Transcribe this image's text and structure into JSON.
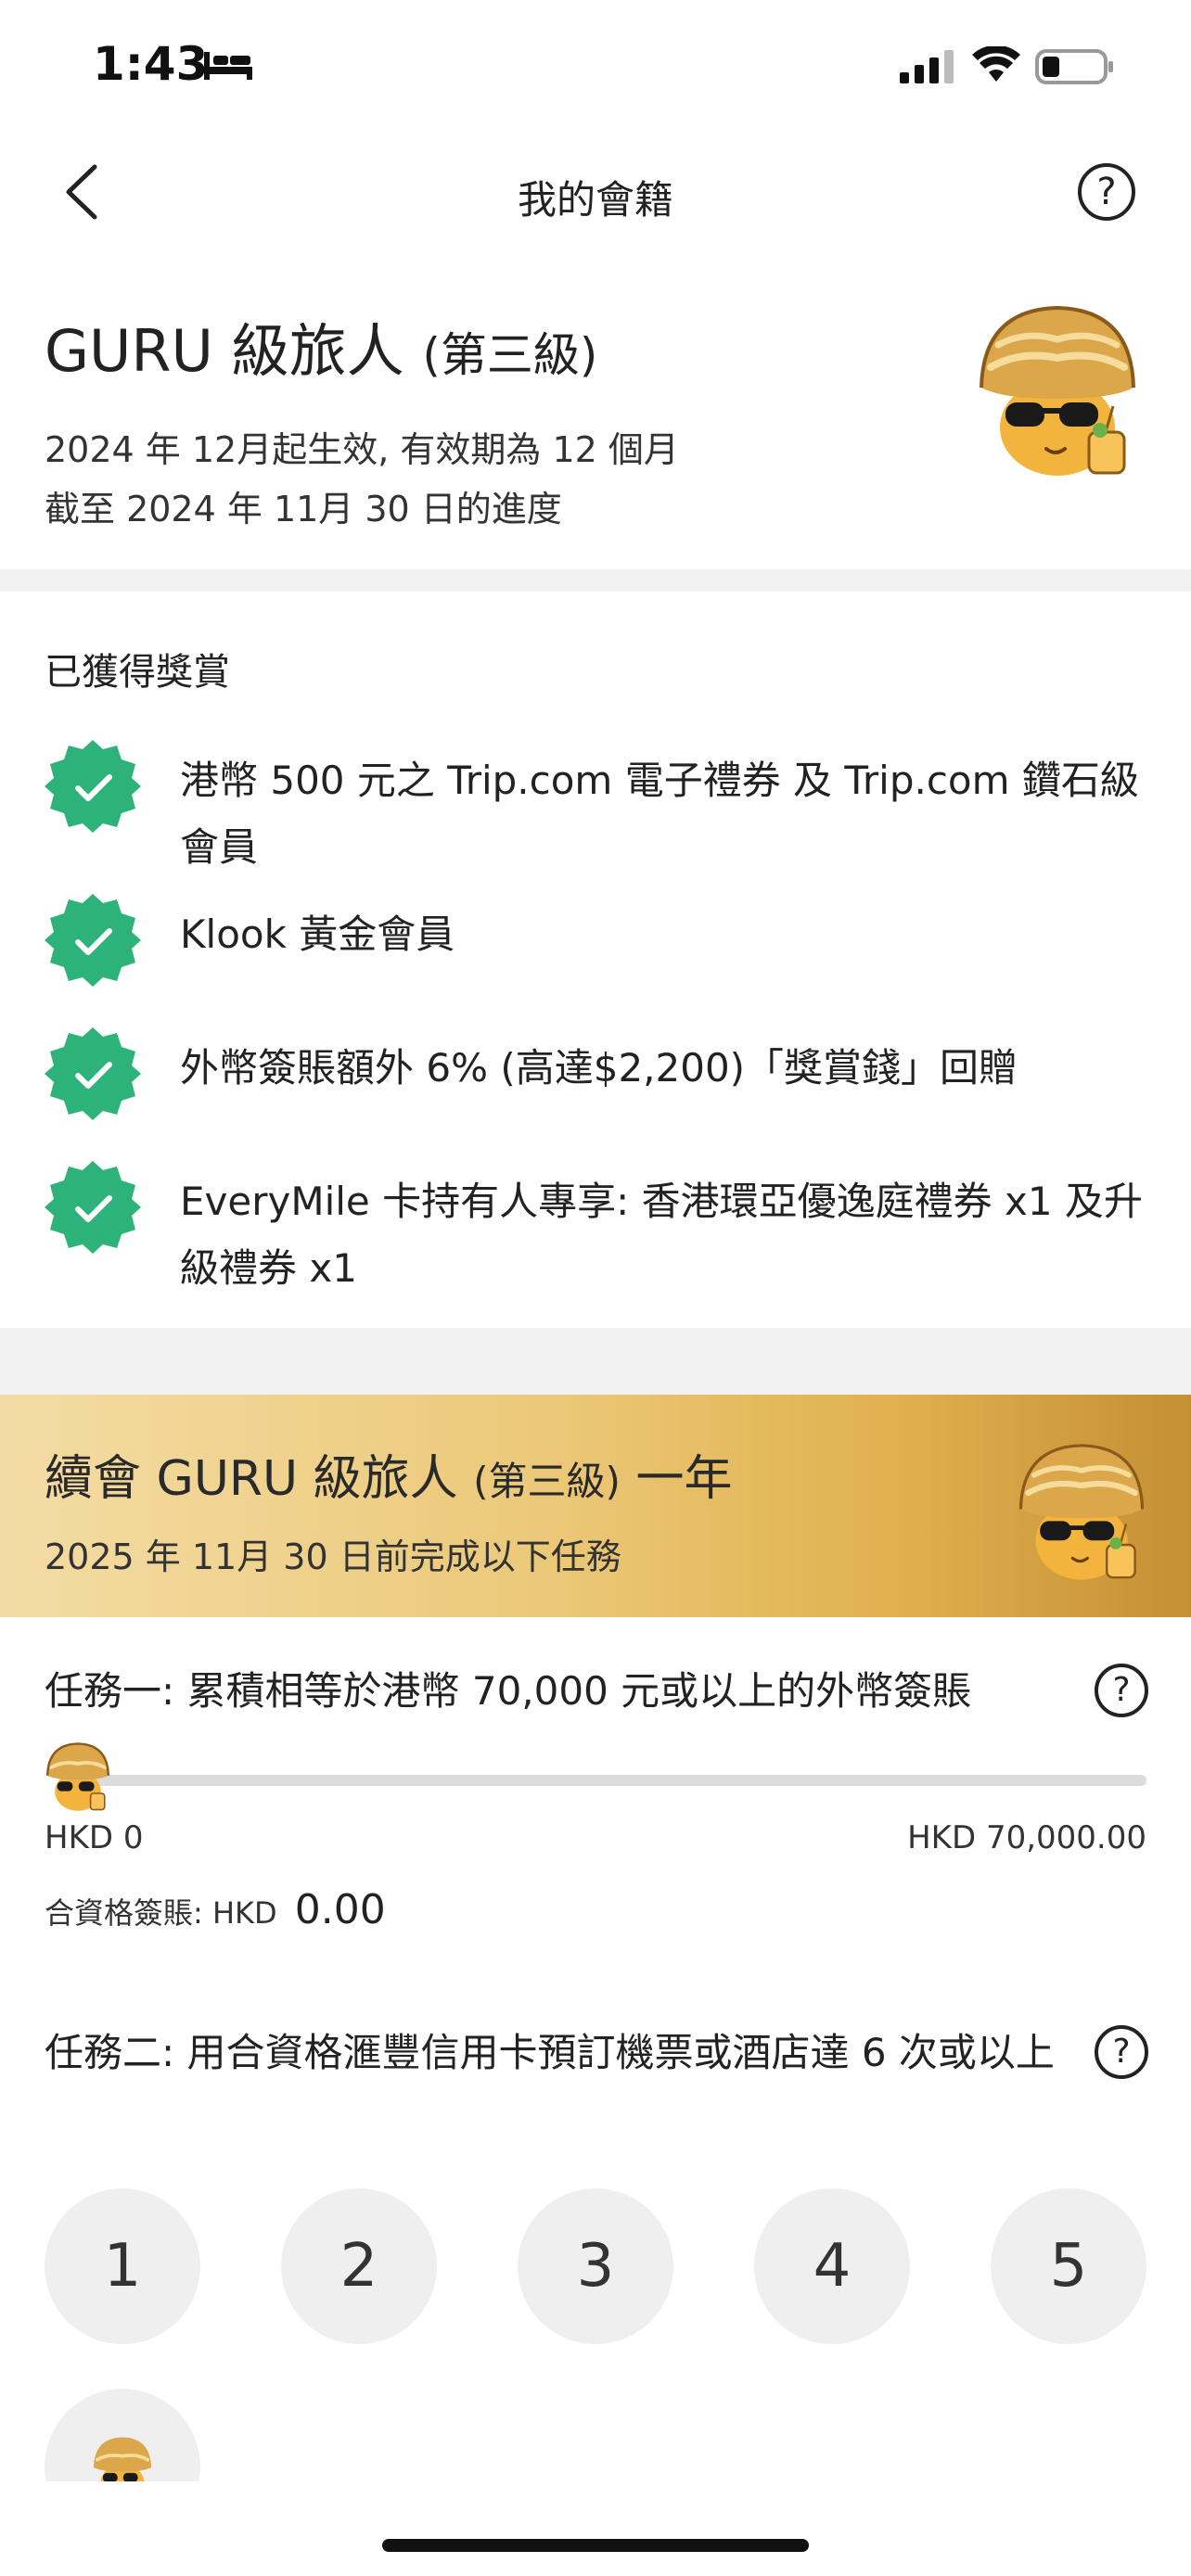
{
  "status_bar": {
    "time": "1:43"
  },
  "nav": {
    "title": "我的會籍",
    "back_icon": "chevron-left-icon",
    "help_icon": "question-mark-icon",
    "help_glyph": "?"
  },
  "tier": {
    "title_main": "GURU 級旅人",
    "title_sub": "(第三級)",
    "effective": "2024 年 12月起生效, 有效期為 12 個月",
    "progress_as_of": "截至 2024 年 11月 30 日的進度"
  },
  "rewards": {
    "heading": "已獲得獎賞",
    "items": [
      {
        "text": "港幣 500 元之 Trip.com 電子禮券 及 Trip.com 鑽石級會員"
      },
      {
        "text": "Klook 黃金會員"
      },
      {
        "text": "外幣簽賬額外 6% (高達$2,200)「獎賞錢」回贈"
      },
      {
        "text": "EveryMile 卡持有人專享: 香港環亞優逸庭禮券 x1 及升級禮券 x1"
      }
    ],
    "colors": {
      "badge": "#2db37a"
    }
  },
  "renew": {
    "title_main": "續會 GURU 級旅人",
    "title_sub": "(第三級)",
    "title_tail": "一年",
    "subtitle": "2025 年 11月 30 日前完成以下任務"
  },
  "task1": {
    "title": "任務一: 累積相等於港幣 70,000 元或以上的外幣簽賬",
    "min_label": "HKD 0",
    "max_label": "HKD 70,000.00",
    "progress_fraction": 0,
    "spend_label": "合資格簽賬: HKD",
    "spend_value": "0.00"
  },
  "task2": {
    "title": "任務二: 用合資格滙豐信用卡預訂機票或酒店達 6 次或以上",
    "steps": [
      "1",
      "2",
      "3",
      "4",
      "5"
    ]
  }
}
